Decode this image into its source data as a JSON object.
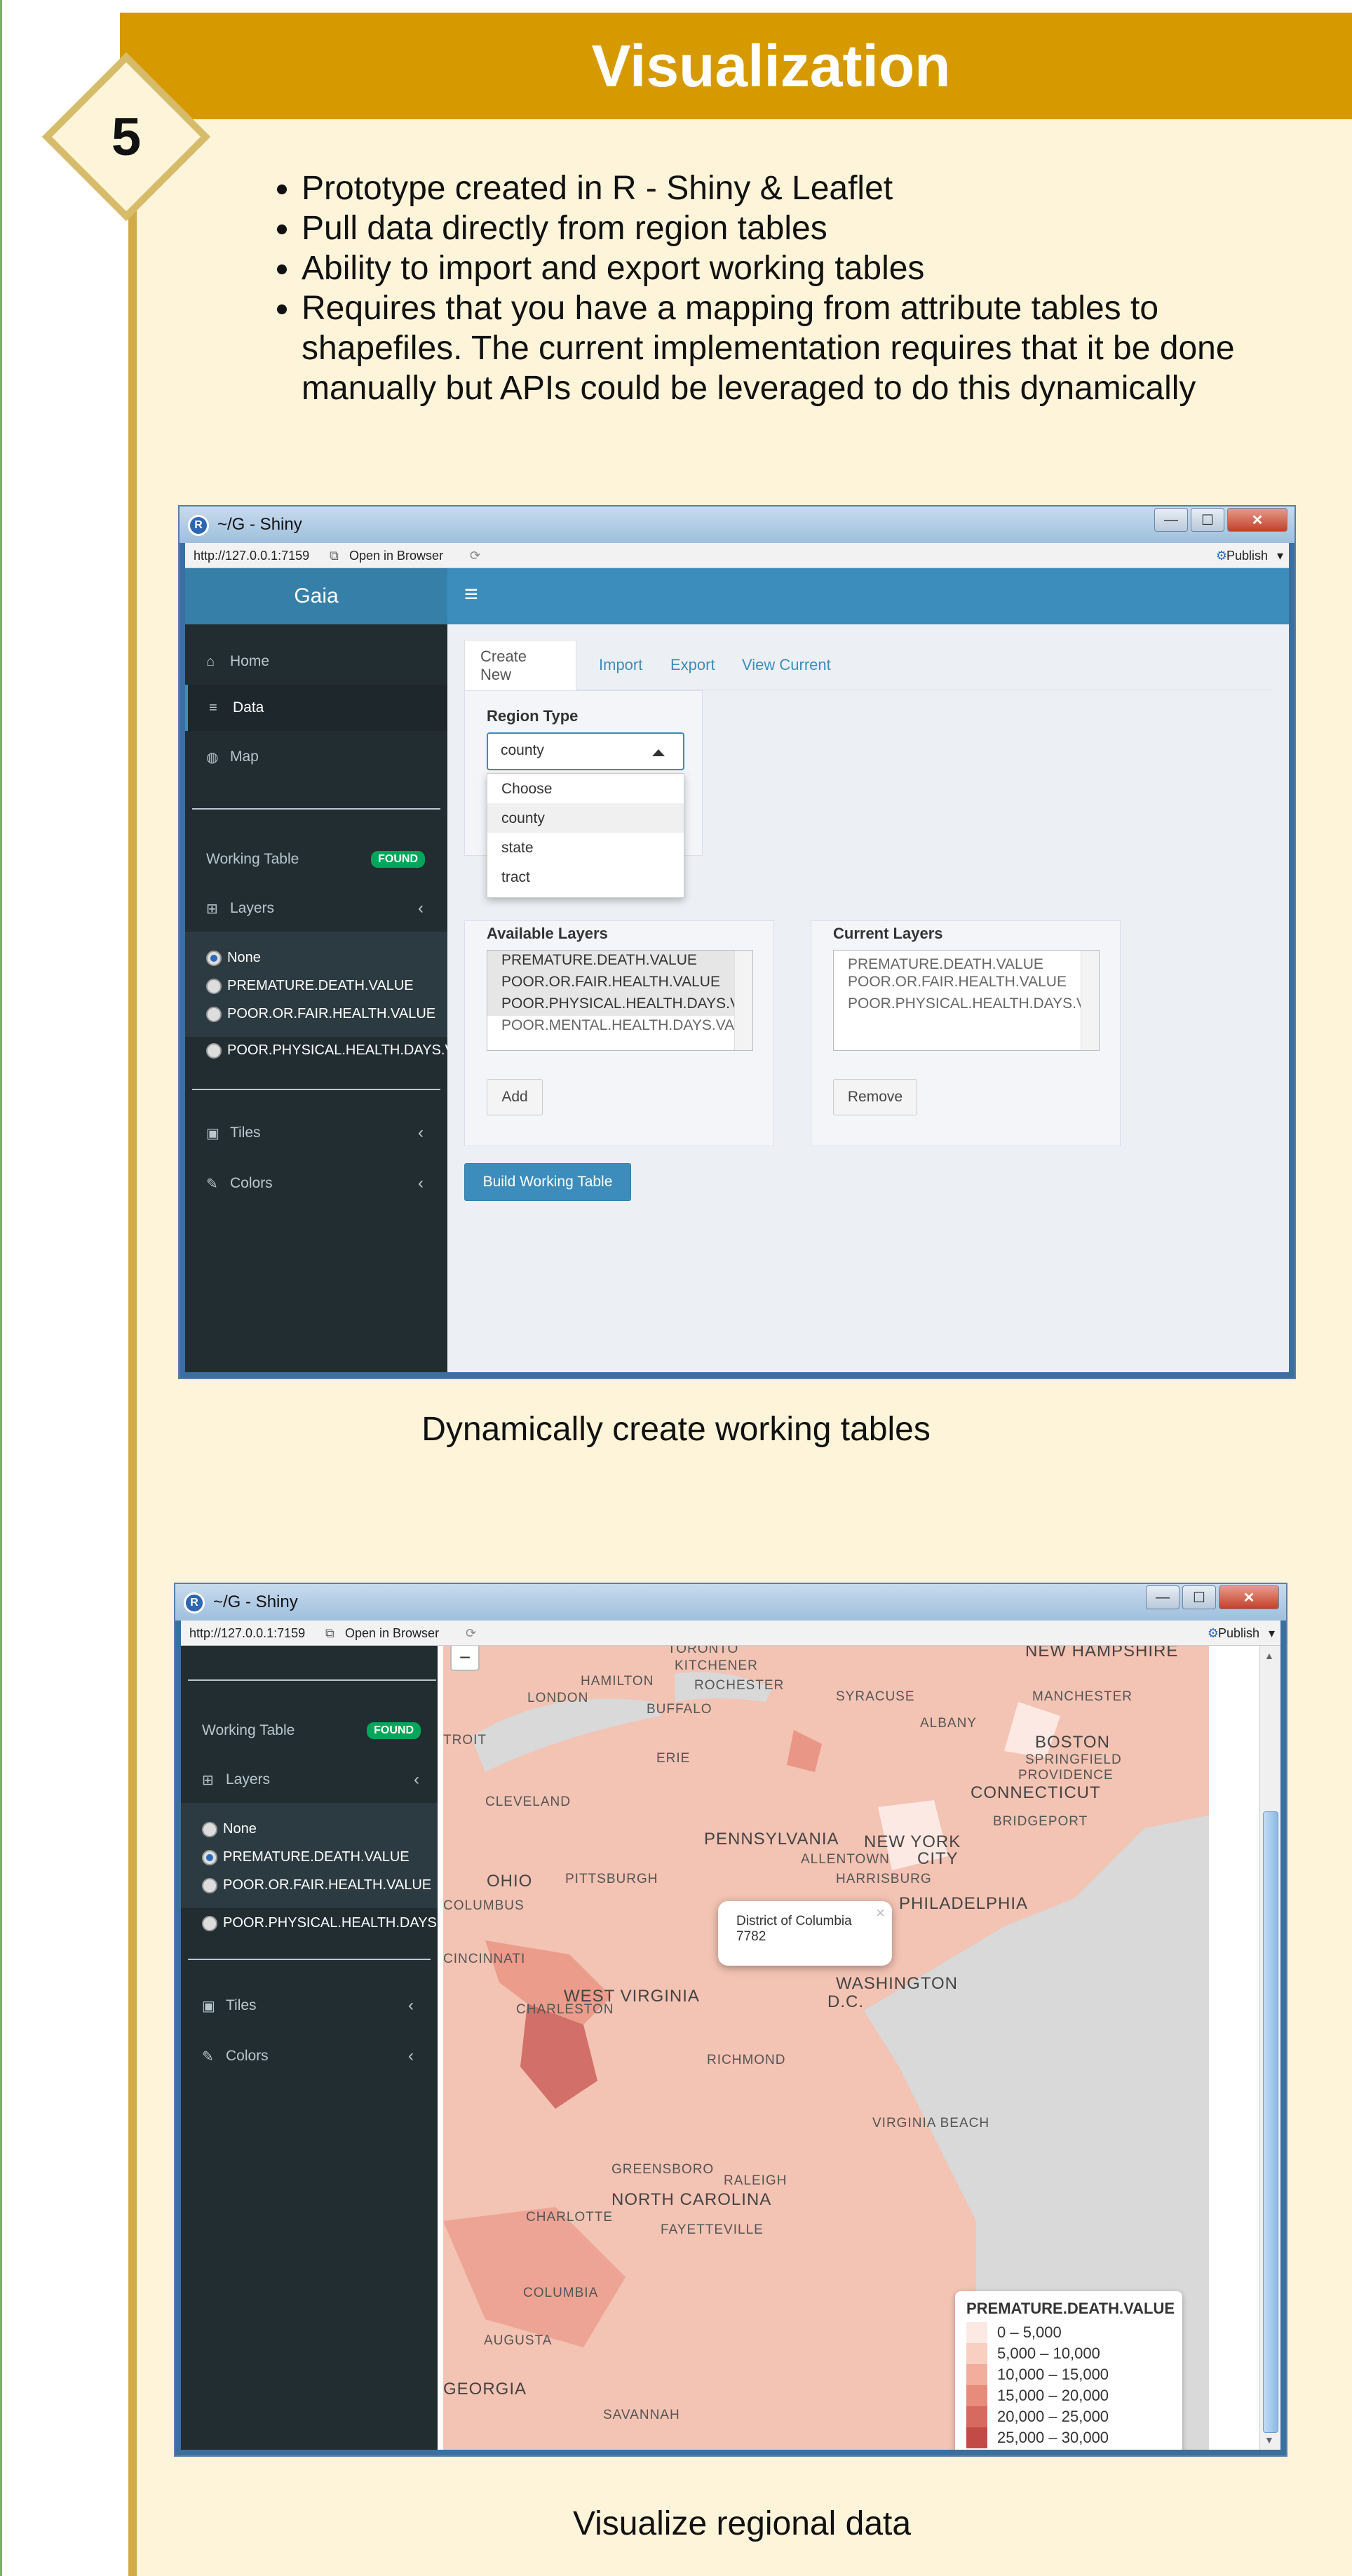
{
  "slide": {
    "number": "5",
    "title": "Visualization",
    "bullets": [
      "Prototype created in R - Shiny & Leaflet",
      "Pull data directly from region tables",
      "Ability to import and export working tables",
      "Requires that you have a mapping from attribute tables to shapefiles. The current implementation requires that it be done manually but APIs could be leveraged to do this dynamically"
    ],
    "caption1": "Dynamically create working tables",
    "caption2": "Visualize regional data"
  },
  "window": {
    "title": "~/G - Shiny",
    "url": "http://127.0.0.1:7159",
    "open_browser": "Open in Browser",
    "publish": "Publish",
    "minimize": "—",
    "maximize": "☐",
    "close": "✕"
  },
  "app": {
    "brand": "Gaia",
    "menu": {
      "home": "Home",
      "data": "Data",
      "map": "Map"
    },
    "working_table": "Working Table",
    "found_badge": "FOUND",
    "layers": "Layers",
    "layer_options": [
      "None",
      "PREMATURE.DEATH.VALUE",
      "POOR.OR.FAIR.HEALTH.VALUE",
      "POOR.PHYSICAL.HEALTH.DAYS.VALUE"
    ],
    "tiles": "Tiles",
    "colors": "Colors",
    "tabs": [
      "Create New",
      "Import",
      "Export",
      "View Current"
    ],
    "region_type_label": "Region Type",
    "region_type_value": "county",
    "region_options": [
      "Choose",
      "county",
      "state",
      "tract"
    ],
    "available_layers_label": "Available Layers",
    "available_layers": [
      "PREMATURE.DEATH.VALUE",
      "POOR.OR.FAIR.HEALTH.VALUE",
      "POOR.PHYSICAL.HEALTH.DAYS.V",
      "POOR.MENTAL.HEALTH.DAYS.VA"
    ],
    "current_layers_label": "Current Layers",
    "current_layers": [
      "PREMATURE.DEATH.VALUE",
      "POOR.OR.FAIR.HEALTH.VALUE",
      "POOR.PHYSICAL.HEALTH.DAYS.V"
    ],
    "add_button": "Add",
    "remove_button": "Remove",
    "build_button": "Build Working Table"
  },
  "map": {
    "zoom_out": "−",
    "labels": [
      "TORONTO",
      "KITCHENER",
      "HAMILTON",
      "ROCHESTER",
      "LONDON",
      "BUFFALO",
      "SYRACUSE",
      "ALBANY",
      "NEW HAMPSHIRE",
      "MANCHESTER",
      "BOSTON",
      "SPRINGFIELD",
      "PROVIDENCE",
      "CONNECTICUT",
      "BRIDGEPORT",
      "ERIE",
      "CLEVELAND",
      "PENNSYLVANIA",
      "NEW YORK",
      "CITY",
      "ALLENTOWN",
      "OHIO",
      "PITTSBURGH",
      "HARRISBURG",
      "PHILADELPHIA",
      "COLUMBUS",
      "CINCINNATI",
      "CHARLESTON",
      "WEST VIRGINIA",
      "WASHINGTON",
      "D.C.",
      "RICHMOND",
      "VIRGINIA BEACH",
      "GREENSBORO",
      "RALEIGH",
      "NORTH CAROLINA",
      "CHARLOTTE",
      "FAYETTEVILLE",
      "COLUMBIA",
      "AUGUSTA",
      "GEORGIA",
      "SAVANNAH",
      "TROIT"
    ],
    "popup_name": "District of Columbia",
    "popup_value": "7782",
    "popup_close": "×",
    "legend_title": "PREMATURE.DEATH.VALUE",
    "legend_items": [
      "0 – 5,000",
      "5,000 – 10,000",
      "10,000 – 15,000",
      "15,000 – 20,000",
      "20,000 – 25,000",
      "25,000 – 30,000"
    ],
    "legend_colors": [
      "#fde9e3",
      "#f9cfc2",
      "#f2ad9c",
      "#e78b7a",
      "#d66a5f",
      "#c24b48"
    ]
  }
}
